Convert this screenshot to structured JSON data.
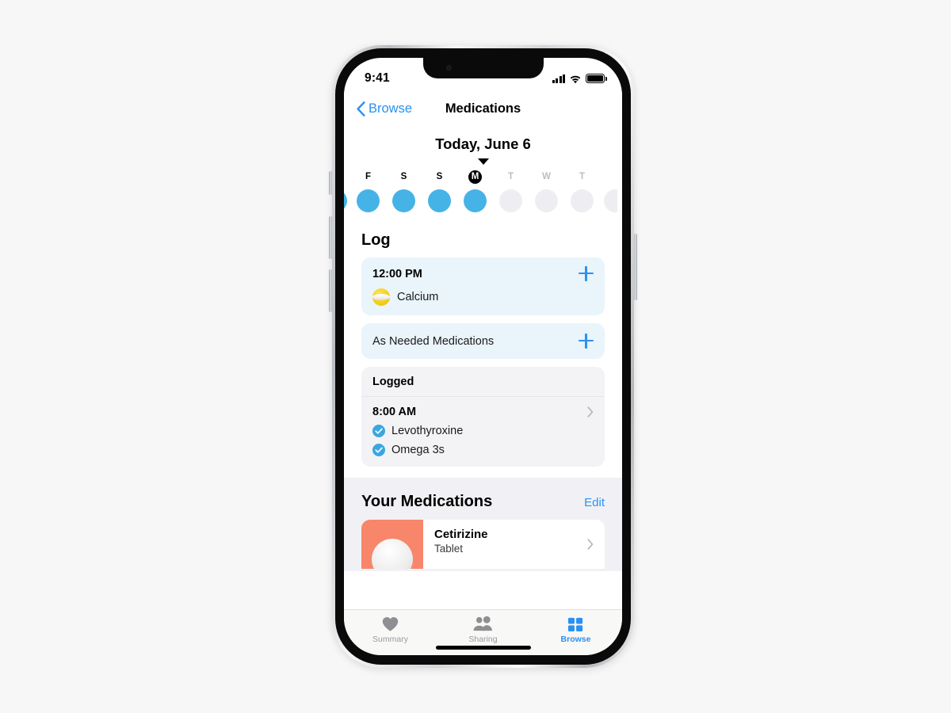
{
  "status_bar": {
    "time": "9:41",
    "cellular_icon": "cellular-bars-icon",
    "wifi_icon": "wifi-icon",
    "battery_icon": "battery-full-icon"
  },
  "nav": {
    "back_label": "Browse",
    "back_icon": "chevron-left-icon",
    "title": "Medications"
  },
  "date_header": {
    "label": "Today, June 6",
    "caret_icon": "caret-down-icon"
  },
  "week_strip": {
    "days": [
      {
        "letter": "",
        "state": "partial",
        "dot": "filled",
        "edge": "left"
      },
      {
        "letter": "F",
        "state": "past",
        "dot": "filled"
      },
      {
        "letter": "S",
        "state": "past",
        "dot": "filled"
      },
      {
        "letter": "S",
        "state": "past",
        "dot": "filled"
      },
      {
        "letter": "M",
        "state": "selected",
        "dot": "filled"
      },
      {
        "letter": "T",
        "state": "future",
        "dot": "empty"
      },
      {
        "letter": "W",
        "state": "future",
        "dot": "empty"
      },
      {
        "letter": "T",
        "state": "future",
        "dot": "empty"
      },
      {
        "letter": "",
        "state": "partial",
        "dot": "empty",
        "edge": "right"
      }
    ]
  },
  "log_section": {
    "title": "Log",
    "scheduled": {
      "time": "12:00 PM",
      "add_icon": "plus-icon",
      "medication": "Calcium",
      "medication_icon": "pill-tablet-icon",
      "icon_color": "#f6cf17"
    },
    "as_needed": {
      "label": "As Needed Medications",
      "add_icon": "plus-icon"
    },
    "logged": {
      "header": "Logged",
      "time": "8:00 AM",
      "disclosure_icon": "chevron-right-icon",
      "items": [
        {
          "name": "Levothyroxine",
          "icon": "check-circle-icon"
        },
        {
          "name": "Omega 3s",
          "icon": "check-circle-icon"
        }
      ]
    }
  },
  "your_medications": {
    "title": "Your Medications",
    "edit_label": "Edit",
    "items": [
      {
        "name": "Cetirizine",
        "form": "Tablet",
        "thumb_color": "#f8866a",
        "disclosure_icon": "chevron-right-icon"
      }
    ]
  },
  "tab_bar": {
    "tabs": [
      {
        "label": "Summary",
        "icon": "heart-icon",
        "active": false
      },
      {
        "label": "Sharing",
        "icon": "two-people-icon",
        "active": false
      },
      {
        "label": "Browse",
        "icon": "grid-squares-icon",
        "active": true
      }
    ]
  },
  "theme": {
    "accent": "#2a91f2",
    "dot_filled": "#46b3e6",
    "dot_empty": "#eeeef2",
    "card_blue": "#eaf4fb",
    "group_grey": "#f1f1f5",
    "page_background": "#f7f7f7"
  }
}
